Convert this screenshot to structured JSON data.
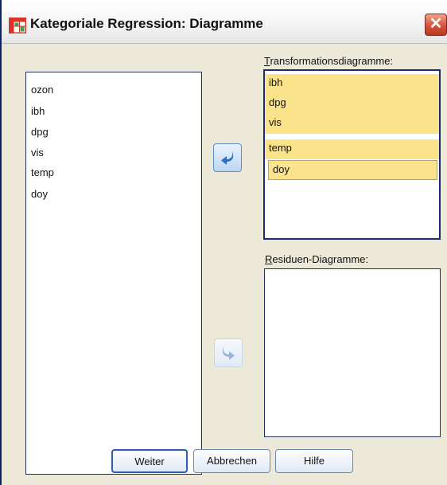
{
  "window": {
    "title": "Kategoriale Regression: Diagramme"
  },
  "title_icons": {
    "app": "table-grid-icon",
    "close": "close-icon"
  },
  "source_list": {
    "items": [
      "ozon",
      "ibh",
      "dpg",
      "vis",
      "temp",
      "doy"
    ]
  },
  "transformation": {
    "label_underlined": "T",
    "label_rest": "ransformationsdiagramme:",
    "items": [
      "ibh",
      "dpg",
      "vis",
      "temp",
      "doy"
    ],
    "focused_item": "doy"
  },
  "residuals": {
    "label_underlined": "R",
    "label_rest": "esiduen-Diagramme:",
    "items": []
  },
  "move_buttons": {
    "to_source_icon": "arrow-left-curved-icon",
    "to_residuals_icon": "arrow-right-curved-icon",
    "to_residuals_enabled": false
  },
  "buttons": {
    "weiter": "Weiter",
    "abbrechen": "Abbrechen",
    "hilfe": "Hilfe"
  },
  "colors": {
    "selection": "#fbe38b",
    "accent": "#2c5fae",
    "close": "#d4533a"
  }
}
